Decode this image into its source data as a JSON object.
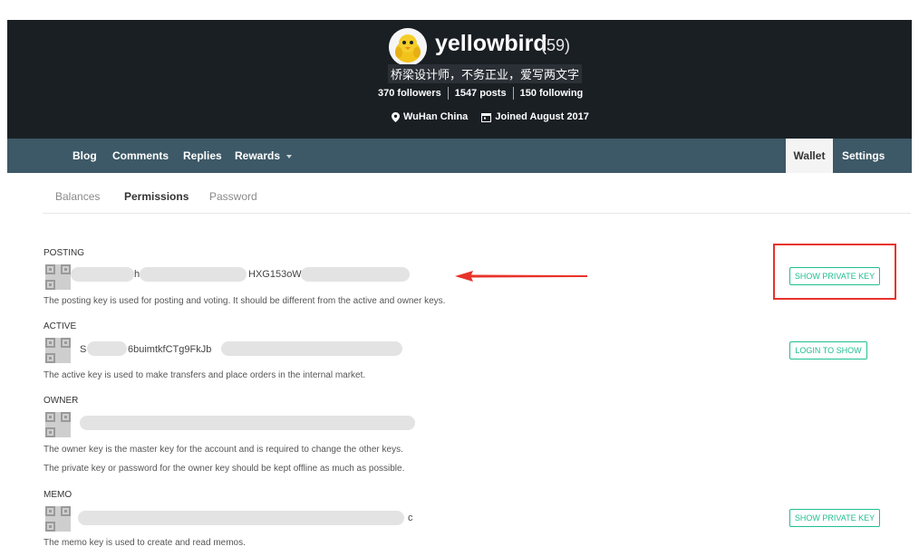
{
  "profile": {
    "username": "yellowbird",
    "reputation": "(59)",
    "tagline": "桥梁设计师，不务正业，爱写两文字",
    "followers": "370 followers",
    "posts": "1547 posts",
    "following": "150 following",
    "location": "WuHan China",
    "joined": "Joined August 2017"
  },
  "nav": {
    "blog": "Blog",
    "comments": "Comments",
    "replies": "Replies",
    "rewards": "Rewards",
    "wallet": "Wallet",
    "settings": "Settings"
  },
  "subtabs": {
    "balances": "Balances",
    "permissions": "Permissions",
    "password": "Password"
  },
  "keys": {
    "posting": {
      "label": "POSTING",
      "key_start": "h",
      "key_mid": "HXG153oW",
      "description": "The posting key is used for posting and voting. It should be different from the active and owner keys.",
      "button": "SHOW PRIVATE KEY"
    },
    "active": {
      "label": "ACTIVE",
      "key_start": "S",
      "key_mid": "6buimtkfCTg9FkJb",
      "description": "The active key is used to make transfers and place orders in the internal market.",
      "button": "LOGIN TO SHOW"
    },
    "owner": {
      "label": "OWNER",
      "description": "The owner key is the master key for the account and is required to change the other keys.",
      "description2": "The private key or password for the owner key should be kept offline as much as possible."
    },
    "memo": {
      "label": "MEMO",
      "key_end": "c",
      "description": "The memo key is used to create and read memos.",
      "button": "SHOW PRIVATE KEY"
    }
  },
  "colors": {
    "header_bg": "#1a1f24",
    "nav_bg": "#3d5866",
    "button_accent": "#1fbf8f",
    "annotation_red": "#e8332a"
  }
}
